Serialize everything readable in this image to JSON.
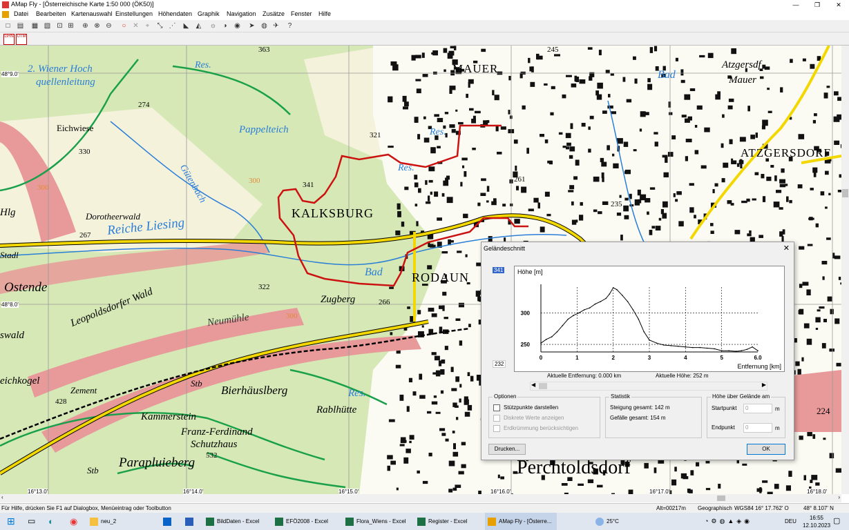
{
  "window": {
    "title": "AMap Fly - [Österreichische Karte 1:50 000 (ÖK50)]",
    "minimize": "—",
    "maximize": "❐",
    "close": "✕"
  },
  "menu": [
    "Datei",
    "Bearbeiten",
    "Kartenauswahl",
    "Einstellungen",
    "Höhendaten",
    "Graphik",
    "Navigation",
    "Zusätze",
    "Fenster",
    "Hilfe"
  ],
  "toolbar2": {
    "ghn": "GHN",
    "utm": "UTM"
  },
  "map": {
    "labels": {
      "wiener_hochquellenleitung_1": "2. Wiener Hoch",
      "wiener_hochquellenleitung_2": "quellenleitung",
      "res1": "Res.",
      "mauer": "MAUER",
      "bad_top": "Bad",
      "atzgersdorf_top": "Atzgersdf",
      "mauer2": "Mauer",
      "pappelteich": "Pappelteich",
      "eichwiese": "Eichwiese",
      "h274": "274",
      "h330": "330",
      "h363": "363",
      "h321": "321",
      "res2": "Res.",
      "res3": "Res.",
      "gutenbach": "Gütenbach",
      "h341": "341",
      "atzgersdorf": "ATZGERSDORF",
      "h261": "261",
      "h235": "235",
      "dorotheerwald": "Dorotheerwald",
      "kalksburg": "KALKSBURG",
      "reiche_liesing": "Reiche Liesing",
      "h267": "267",
      "stadl": "Stadl",
      "ostende": "Ostende",
      "h322": "322",
      "bad_mid": "Bad",
      "rodaun": "RODAUN",
      "zugberg": "Zugberg",
      "h266": "266",
      "leopoldsdorfer_wald": "Leopoldsdorfer Wald",
      "neumuhle": "Neumühle",
      "swald": "swald",
      "eichkogel": "eichkogel",
      "zement": "Zement",
      "h428": "428",
      "stb1": "Stb",
      "bierhauslberg": "Bierhäuslberg",
      "res4": "Res.",
      "rablhutte": "Rablhütte",
      "kammerstein": "Kammerstein",
      "franz_ferdinand": "Franz-Ferdinand",
      "schutzhaus": "Schutzhaus",
      "h532": "532",
      "parapluieberg": "Parapluieberg",
      "stb2": "Stb",
      "perchtoldsdorf": "Perchtoldsdorf",
      "h245": "245",
      "h224": "224",
      "h300a": "300",
      "h300b": "300",
      "h300c": "300",
      "hlg": "Hlg"
    },
    "coords": {
      "lat_90": "48°9.0'",
      "lat_80": "48°8.0'",
      "lon_130": "16°13.0'",
      "lon_140": "16°14.0'",
      "lon_150": "16°15.0'",
      "lon_160": "16°16.0'",
      "lon_170": "16°17.0'",
      "lon_180": "16°18.0'"
    }
  },
  "dialog": {
    "title": "Geländeschnitt",
    "close": "✕",
    "ymax_box": "341",
    "ymin_box": "232",
    "current_distance": "Aktuelle Entfernung: 0.000 km",
    "current_height": "Aktuelle Höhe: 252 m",
    "options": {
      "label": "Optionen",
      "items": [
        "Stützpunkte darstellen",
        "Diskrete Werte anzeigen",
        "Erdkrümmung berücksichtigen"
      ]
    },
    "statistik": {
      "label": "Statistik",
      "steigung": "Steigung gesamt: 142 m",
      "gefaelle": "Gefälle gesamt: 154 m"
    },
    "hoehe": {
      "label": "Höhe über Gelände am",
      "startpunkt": "Startpunkt",
      "endpunkt": "Endpunkt",
      "start_value": "0",
      "end_value": "0",
      "unit": "m"
    },
    "print_button": "Drucken...",
    "ok_button": "OK"
  },
  "chart_data": {
    "type": "line",
    "ylabel": "Höhe [m]",
    "xlabel": "Entfernung [km]",
    "xlim": [
      0,
      6.0
    ],
    "ylim": [
      238,
      341
    ],
    "x_ticks": [
      "0",
      "1",
      "2",
      "3",
      "4",
      "5",
      "6.0"
    ],
    "y_ticks": [
      "300",
      "250"
    ],
    "y_tick_values": [
      300,
      250
    ],
    "x": [
      0,
      0.15,
      0.3,
      0.45,
      0.6,
      0.75,
      0.9,
      1.05,
      1.2,
      1.35,
      1.5,
      1.65,
      1.8,
      1.9,
      2.0,
      2.1,
      2.25,
      2.4,
      2.55,
      2.7,
      2.85,
      3.0,
      3.2,
      3.4,
      3.6,
      3.8,
      4.0,
      4.2,
      4.4,
      4.6,
      4.8,
      5.0,
      5.2,
      5.4,
      5.55,
      5.7,
      5.85,
      6.0
    ],
    "y": [
      252,
      258,
      262,
      270,
      280,
      290,
      296,
      300,
      305,
      308,
      314,
      318,
      323,
      330,
      340,
      337,
      328,
      318,
      305,
      290,
      270,
      257,
      252,
      249,
      248,
      247,
      246,
      245,
      245,
      244,
      243,
      240,
      240,
      239,
      240,
      242,
      246,
      240
    ]
  },
  "status": {
    "help": "Für Hilfe, drücken Sie F1 auf Dialogbox, Menüeintrag oder Toolbutton",
    "alt": "Alt=00217m",
    "geo": "Geographisch",
    "wgs": "WGS84",
    "lon": "16° 17.762' O",
    "lat": "48° 8.107' N"
  },
  "taskbar": {
    "apps": [
      "neu_2",
      "BildDaten - Excel",
      "EFÖ2008 - Excel",
      "Flora_Wiens - Excel",
      "Register - Excel",
      "AMap Fly - [Österre..."
    ],
    "weather": "25°C",
    "lang": "DEU",
    "time": "16:55",
    "date": "12.10.2023"
  },
  "colors": {
    "route": "#cc1111",
    "road": "#f2d800",
    "trail": "#1aa04a",
    "water": "#2a7ed8",
    "forest": "#c8e0a8",
    "forest_dark": "#aad08a",
    "protected": "#e08a8a",
    "urban": "#fdfdf5"
  }
}
